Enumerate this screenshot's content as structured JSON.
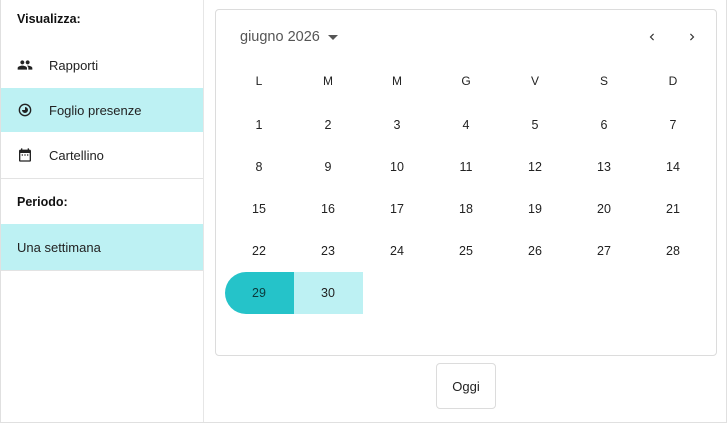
{
  "sidebar": {
    "view_heading": "Visualizza:",
    "view_items": [
      {
        "label": "Rapporti",
        "icon": "people-icon",
        "selected": false
      },
      {
        "label": "Foglio presenze",
        "icon": "timelapse-icon",
        "selected": true
      },
      {
        "label": "Cartellino",
        "icon": "calendar-icon",
        "selected": false
      }
    ],
    "period_heading": "Periodo:",
    "period_items": [
      {
        "label": "Una settimana",
        "selected": true
      }
    ]
  },
  "calendar": {
    "month_label": "giugno 2026",
    "weekdays": [
      "L",
      "M",
      "M",
      "G",
      "V",
      "S",
      "D"
    ],
    "weeks": [
      [
        "1",
        "2",
        "3",
        "4",
        "5",
        "6",
        "7"
      ],
      [
        "8",
        "9",
        "10",
        "11",
        "12",
        "13",
        "14"
      ],
      [
        "15",
        "16",
        "17",
        "18",
        "19",
        "20",
        "21"
      ],
      [
        "22",
        "23",
        "24",
        "25",
        "26",
        "27",
        "28"
      ],
      [
        "29",
        "30"
      ]
    ],
    "range_start": "29",
    "range_days": [
      "30"
    ],
    "accent_color": "#25c3c9",
    "range_color": "#bdf1f3"
  },
  "today_button": "Oggi"
}
